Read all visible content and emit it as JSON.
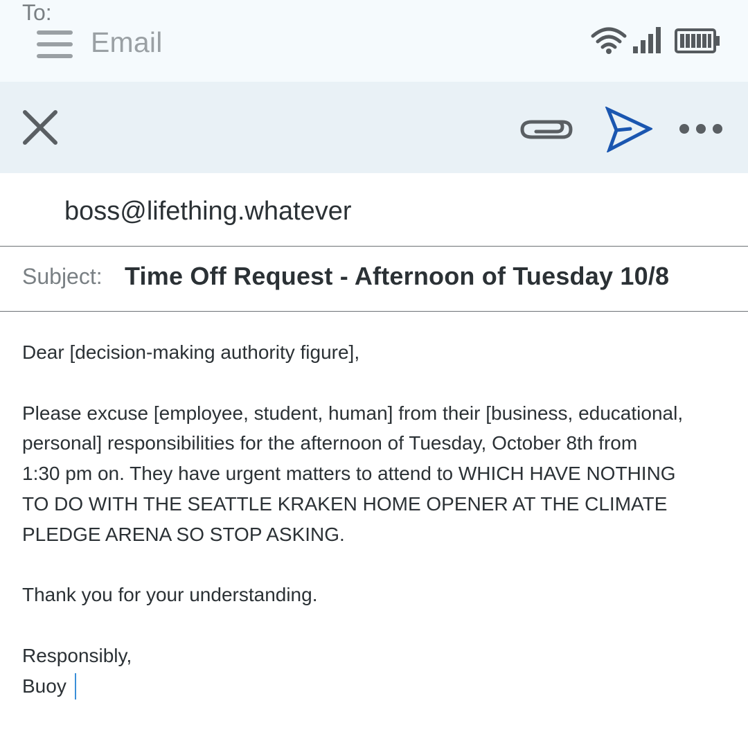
{
  "app_bar": {
    "title": "Email",
    "menu_icon": "hamburger-menu-icon",
    "status_icons": [
      "wifi-icon",
      "cellular-signal-icon",
      "battery-icon"
    ]
  },
  "toolbar": {
    "icons": [
      "close-icon",
      "paperclip-icon",
      "send-icon",
      "more-options-icon"
    ],
    "send_color": "#1a56b0"
  },
  "compose": {
    "to_label": "To:",
    "to_value": "boss@lifething.whatever",
    "subject_label": "Subject:",
    "subject_value": "Time Off Request - Afternoon of Tuesday 10/8"
  },
  "body": {
    "greeting": "Dear [decision-making authority figure],",
    "paragraph_line1": "Please excuse [employee, student, human] from their [business, educational,",
    "paragraph_line2": "personal] responsibilities for the afternoon of Tuesday, October 8th from",
    "paragraph_line3": "1:30 pm on. They have urgent matters to attend to WHICH HAVE NOTHING",
    "paragraph_line4": "TO DO WITH THE SEATTLE KRAKEN HOME OPENER AT THE CLIMATE",
    "paragraph_line5": "PLEDGE ARENA SO STOP ASKING.",
    "thanks": "Thank you for your understanding.",
    "signoff": "Responsibly,",
    "signature": "Buoy"
  }
}
